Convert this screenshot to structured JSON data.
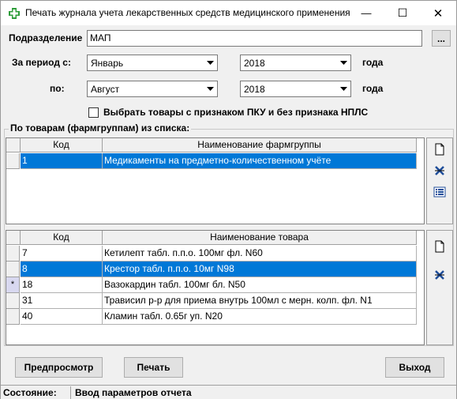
{
  "window": {
    "title": "Печать журнала учета лекарственных средств медицинского применения",
    "minimize": "—",
    "maximize": "☐",
    "close": "✕"
  },
  "department": {
    "label": "Подразделение",
    "value": "МАП",
    "browse": "..."
  },
  "period": {
    "from_label": "За период  с:",
    "to_label": "по:",
    "from_month": "Январь",
    "from_year": "2018",
    "to_month": "Август",
    "to_year": "2018",
    "year_suffix": "года"
  },
  "checkbox": {
    "label": "Выбрать товары с признаком ПКУ и без признака НПЛС",
    "checked": false
  },
  "groups_section": {
    "label": "По товарам (фармгруппам) из списка:",
    "columns": [
      "Код",
      "Наименование фармгруппы"
    ],
    "rows": [
      {
        "code": "1",
        "name": "Медикаменты на предметно-количественном учёте",
        "selected": true
      }
    ]
  },
  "goods_section": {
    "columns": [
      "Код",
      "Наименование товара"
    ],
    "rows": [
      {
        "code": "7",
        "name": "Кетилепт табл. п.п.о. 100мг фл. N60",
        "indicator": "",
        "selected": false
      },
      {
        "code": "8",
        "name": "Крестор табл. п.п.о. 10мг N98",
        "indicator": "",
        "selected": true
      },
      {
        "code": "18",
        "name": "Вазокардин табл. 100мг бл. N50",
        "indicator": "*",
        "selected": false
      },
      {
        "code": "31",
        "name": "Трависил р-р для приема внутрь 100мл с мерн. колп. фл. N1",
        "indicator": "",
        "selected": false
      },
      {
        "code": "40",
        "name": "Кламин табл. 0.65г уп. N20",
        "indicator": "",
        "selected": false
      }
    ]
  },
  "buttons": {
    "preview": "Предпросмотр",
    "print": "Печать",
    "exit": "Выход"
  },
  "status": {
    "label": "Состояние:",
    "value": "Ввод параметров отчета"
  },
  "colors": {
    "selection": "#0078d7",
    "window_bg": "#f0f0f0",
    "icon_blue": "#1f4e9a",
    "title_icon_green": "#2e9d3a"
  }
}
